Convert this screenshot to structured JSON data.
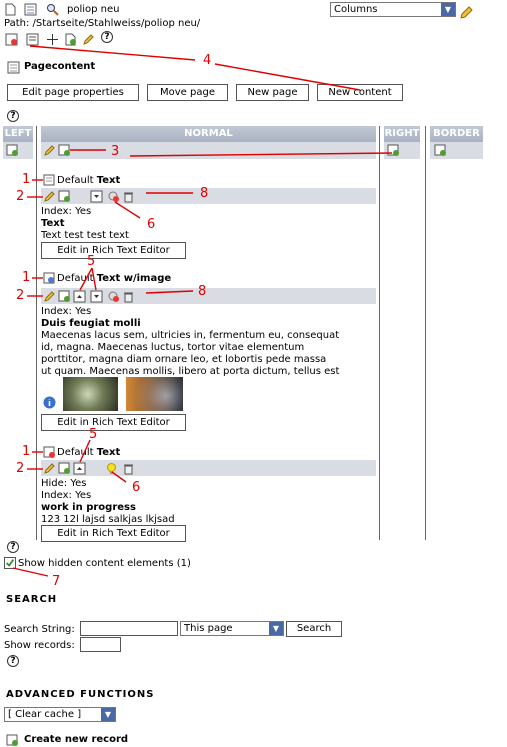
{
  "header": {
    "page_title": "poliop neu",
    "path": "Path: /Startseite/Stahlweiss/poliop neu/",
    "view_select": "Columns"
  },
  "section_title": "Pagecontent",
  "buttons": {
    "edit_props": "Edit page properties",
    "move_page": "Move page",
    "new_page": "New page",
    "new_content": "New content"
  },
  "columns": {
    "left": "LEFT",
    "normal": "NORMAL",
    "right": "RIGHT",
    "border": "BORDER"
  },
  "elements": [
    {
      "type_label": "Default",
      "type_bold": "Text",
      "info": "Index: Yes",
      "heading": "Text",
      "body": "Text test test text",
      "rte_button": "Edit in Rich Text Editor"
    },
    {
      "type_label": "Default",
      "type_bold": "Text w/image",
      "info": "Index: Yes",
      "heading": "Duis feugiat molli",
      "body_lines": [
        "Maecenas lacus sem, ultricies in, fermentum eu, consequat",
        "id, magna. Maecenas luctus, tortor vitae elementum",
        "porttitor, magna diam ornare leo, et lobortis pede massa",
        "ut quam. Maecenas mollis, libero at porta dictum, tellus est"
      ],
      "rte_button": "Edit in Rich Text Editor"
    },
    {
      "type_label": "Default",
      "type_bold": "Text",
      "hide": "Hide: Yes",
      "info": "Index: Yes",
      "heading": "work in progress",
      "body": "123 12l lajsd salkjas lkjsad",
      "rte_button": "Edit in Rich Text Editor"
    }
  ],
  "show_hidden_label": "Show hidden content elements (1)",
  "search": {
    "title": "SEARCH",
    "string_label": "Search String:",
    "scope": "This page",
    "button": "Search",
    "show_records_label": "Show records:"
  },
  "advanced": {
    "title": "ADVANCED FUNCTIONS",
    "cache_select": "[ Clear cache ]"
  },
  "create_record": "Create new record",
  "annotations": [
    "1",
    "2",
    "3",
    "4",
    "5",
    "6",
    "7",
    "8"
  ],
  "colors": {
    "annotation": "#e10000",
    "column_header": "#b3bbca",
    "select_arrow": "#4a67a6"
  }
}
